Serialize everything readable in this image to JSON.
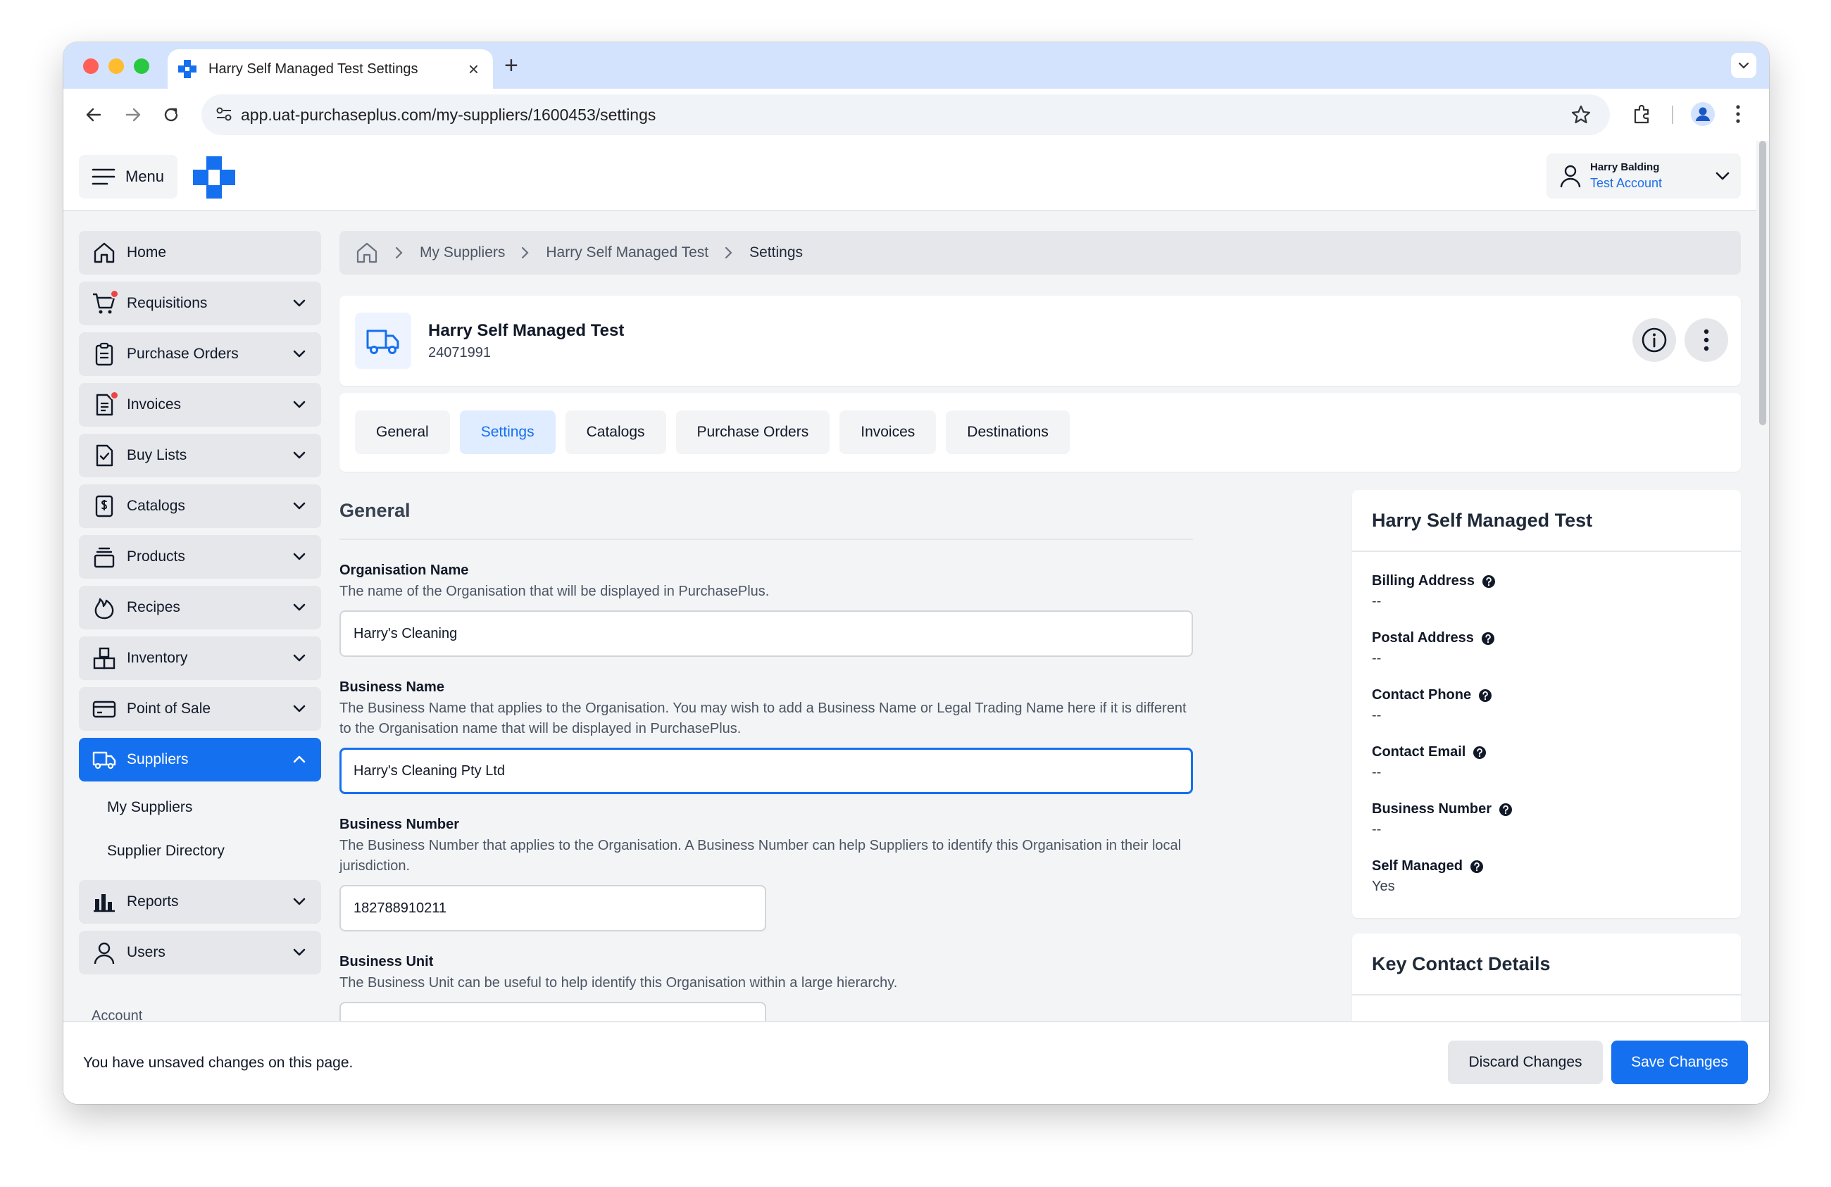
{
  "browser": {
    "tab_title": "Harry Self Managed Test Settings",
    "tab_close": "×",
    "new_tab": "+",
    "url": "app.uat-purchaseplus.com/my-suppliers/1600453/settings"
  },
  "header": {
    "menu_label": "Menu",
    "user_name": "Harry Balding",
    "account_name": "Test Account"
  },
  "sidebar": {
    "items": [
      {
        "label": "Home"
      },
      {
        "label": "Requisitions"
      },
      {
        "label": "Purchase Orders"
      },
      {
        "label": "Invoices"
      },
      {
        "label": "Buy Lists"
      },
      {
        "label": "Catalogs"
      },
      {
        "label": "Products"
      },
      {
        "label": "Recipes"
      },
      {
        "label": "Inventory"
      },
      {
        "label": "Point of Sale"
      },
      {
        "label": "Suppliers"
      },
      {
        "label": "Reports"
      },
      {
        "label": "Users"
      }
    ],
    "sub_items": [
      {
        "label": "My Suppliers"
      },
      {
        "label": "Supplier Directory"
      }
    ],
    "account_label": "Account"
  },
  "breadcrumb": {
    "items": [
      "My Suppliers",
      "Harry Self Managed Test",
      "Settings"
    ]
  },
  "supplier": {
    "name": "Harry Self Managed Test",
    "id": "24071991"
  },
  "tabs": [
    {
      "label": "General"
    },
    {
      "label": "Settings"
    },
    {
      "label": "Catalogs"
    },
    {
      "label": "Purchase Orders"
    },
    {
      "label": "Invoices"
    },
    {
      "label": "Destinations"
    }
  ],
  "form": {
    "title": "General",
    "fields": [
      {
        "label": "Organisation Name",
        "help": "The name of the Organisation that will be displayed in PurchasePlus.",
        "value": "Harry's Cleaning"
      },
      {
        "label": "Business Name",
        "help": "The Business Name that applies to the Organisation. You may wish to add a Business Name or Legal Trading Name here if it is different to the Organisation name that will be displayed in PurchasePlus.",
        "value": "Harry's Cleaning Pty Ltd"
      },
      {
        "label": "Business Number",
        "help": "The Business Number that applies to the Organisation. A Business Number can help Suppliers to identify this Organisation in their local jurisdiction.",
        "value": "182788910211"
      },
      {
        "label": "Business Unit",
        "help": "The Business Unit can be useful to help identify this Organisation within a large hierarchy.",
        "value": ""
      }
    ]
  },
  "details": {
    "title": "Harry Self Managed Test",
    "rows": [
      {
        "label": "Billing Address",
        "value": "--"
      },
      {
        "label": "Postal Address",
        "value": "--"
      },
      {
        "label": "Contact Phone",
        "value": "--"
      },
      {
        "label": "Contact Email",
        "value": "--"
      },
      {
        "label": "Business Number",
        "value": "--"
      },
      {
        "label": "Self Managed",
        "value": "Yes"
      }
    ]
  },
  "contact": {
    "title": "Key Contact Details"
  },
  "unsaved": {
    "message": "You have unsaved changes on this page.",
    "discard_label": "Discard Changes",
    "save_label": "Save Changes"
  },
  "colors": {
    "accent": "#1570ef",
    "sidebar_bg": "#e5e7eb",
    "page_bg": "#f3f4f6",
    "notification_dot": "#ef4444"
  }
}
